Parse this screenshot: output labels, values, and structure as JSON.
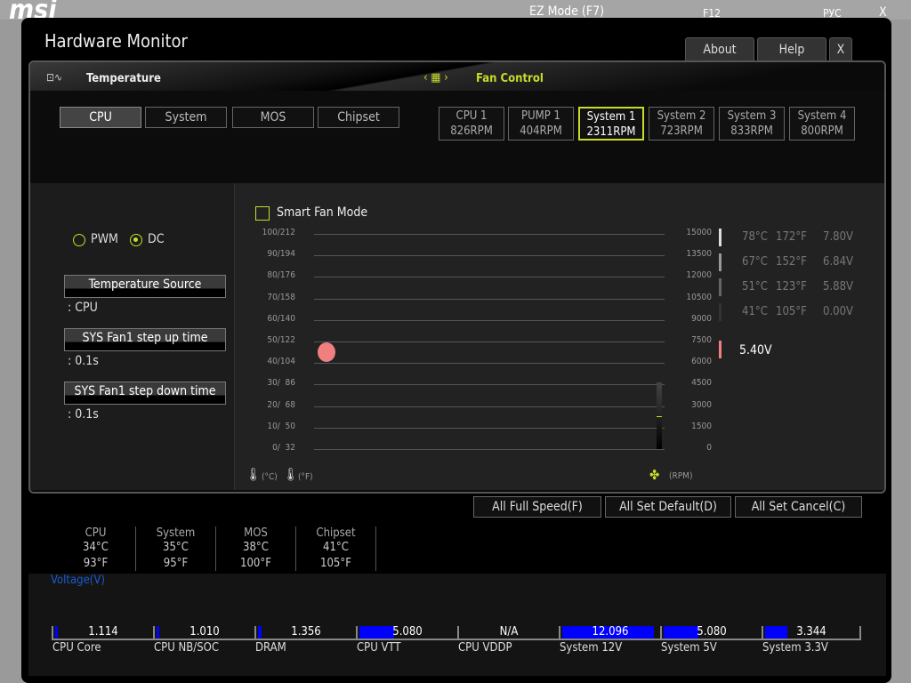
{
  "background": {
    "logo": "msi",
    "ez_mode": "EZ Mode (F7)",
    "f12": "F12",
    "language": "РУС",
    "close": "X"
  },
  "dialog": {
    "title": "Hardware Monitor",
    "tabs": [
      "About",
      "Help",
      "X"
    ]
  },
  "sections": {
    "temperature": "Temperature",
    "fan_control": "Fan Control"
  },
  "temp_sources": [
    {
      "label": "CPU",
      "selected": true
    },
    {
      "label": "System",
      "selected": false
    },
    {
      "label": "MOS",
      "selected": false
    },
    {
      "label": "Chipset",
      "selected": false
    }
  ],
  "fans": [
    {
      "name": "CPU 1",
      "rpm": "826RPM"
    },
    {
      "name": "PUMP 1",
      "rpm": "404RPM"
    },
    {
      "name": "System 1",
      "rpm": "2311RPM",
      "selected": true
    },
    {
      "name": "System 2",
      "rpm": "723RPM"
    },
    {
      "name": "System 3",
      "rpm": "833RPM"
    },
    {
      "name": "System 4",
      "rpm": "800RPM"
    }
  ],
  "mode": {
    "pwm": "PWM",
    "dc": "DC",
    "selected": "DC"
  },
  "settings": [
    {
      "label": "Temperature Source",
      "value": ": CPU"
    },
    {
      "label": "SYS Fan1 step up time",
      "value": ": 0.1s"
    },
    {
      "label": "SYS Fan1 step down time",
      "value": ": 0.1s"
    }
  ],
  "smart_fan_mode": {
    "label": "Smart Fan Mode",
    "checked": false
  },
  "chart_data": {
    "type": "scatter",
    "left_ticks": [
      "100/212",
      "90/194",
      "80/176",
      "70/158",
      "60/140",
      "50/122",
      "40/104",
      "30/  86",
      "20/  68",
      "10/  50",
      "0/  32"
    ],
    "right_ticks": [
      "15000",
      "13500",
      "12000",
      "10500",
      "9000",
      "7500",
      "6000",
      "4500",
      "3000",
      "1500",
      "0"
    ],
    "left_unit": "(°C)",
    "left_unit_f": "(°F)",
    "right_unit": "(RPM)",
    "point": {
      "temp_c": 45,
      "color": "#f08080"
    },
    "current_rpm": 2311,
    "ylim": [
      0,
      15000
    ]
  },
  "legend": [
    {
      "c": "78°C",
      "f": "172°F",
      "v": "7.80V",
      "color": "#dddddd"
    },
    {
      "c": "67°C",
      "f": "152°F",
      "v": "6.84V",
      "color": "#999999"
    },
    {
      "c": "51°C",
      "f": "123°F",
      "v": "5.88V",
      "color": "#666666"
    },
    {
      "c": "41°C",
      "f": "105°F",
      "v": "0.00V",
      "color": "#333333"
    }
  ],
  "current_voltage": {
    "v": "5.40V",
    "color": "#f08080"
  },
  "actions": [
    "All Full Speed(F)",
    "All Set Default(D)",
    "All Set Cancel(C)"
  ],
  "temps": [
    {
      "name": "CPU",
      "c": "34°C",
      "f": "93°F"
    },
    {
      "name": "System",
      "c": "35°C",
      "f": "95°F"
    },
    {
      "name": "MOS",
      "c": "38°C",
      "f": "100°F"
    },
    {
      "name": "Chipset",
      "c": "41°C",
      "f": "105°F"
    }
  ],
  "voltage": {
    "title": "Voltage(V)",
    "items": [
      {
        "name": "CPU Core",
        "value": "1.114",
        "fill": 3
      },
      {
        "name": "CPU NB/SOC",
        "value": "1.010",
        "fill": 3
      },
      {
        "name": "DRAM",
        "value": "1.356",
        "fill": 4
      },
      {
        "name": "CPU VTT",
        "value": "5.080",
        "fill": 35
      },
      {
        "name": "CPU VDDP",
        "value": "N/A",
        "fill": 0
      },
      {
        "name": "System 12V",
        "value": "12.096",
        "fill": 92
      },
      {
        "name": "System 5V",
        "value": "5.080",
        "fill": 35
      },
      {
        "name": "System 3.3V",
        "value": "3.344",
        "fill": 23
      }
    ]
  }
}
